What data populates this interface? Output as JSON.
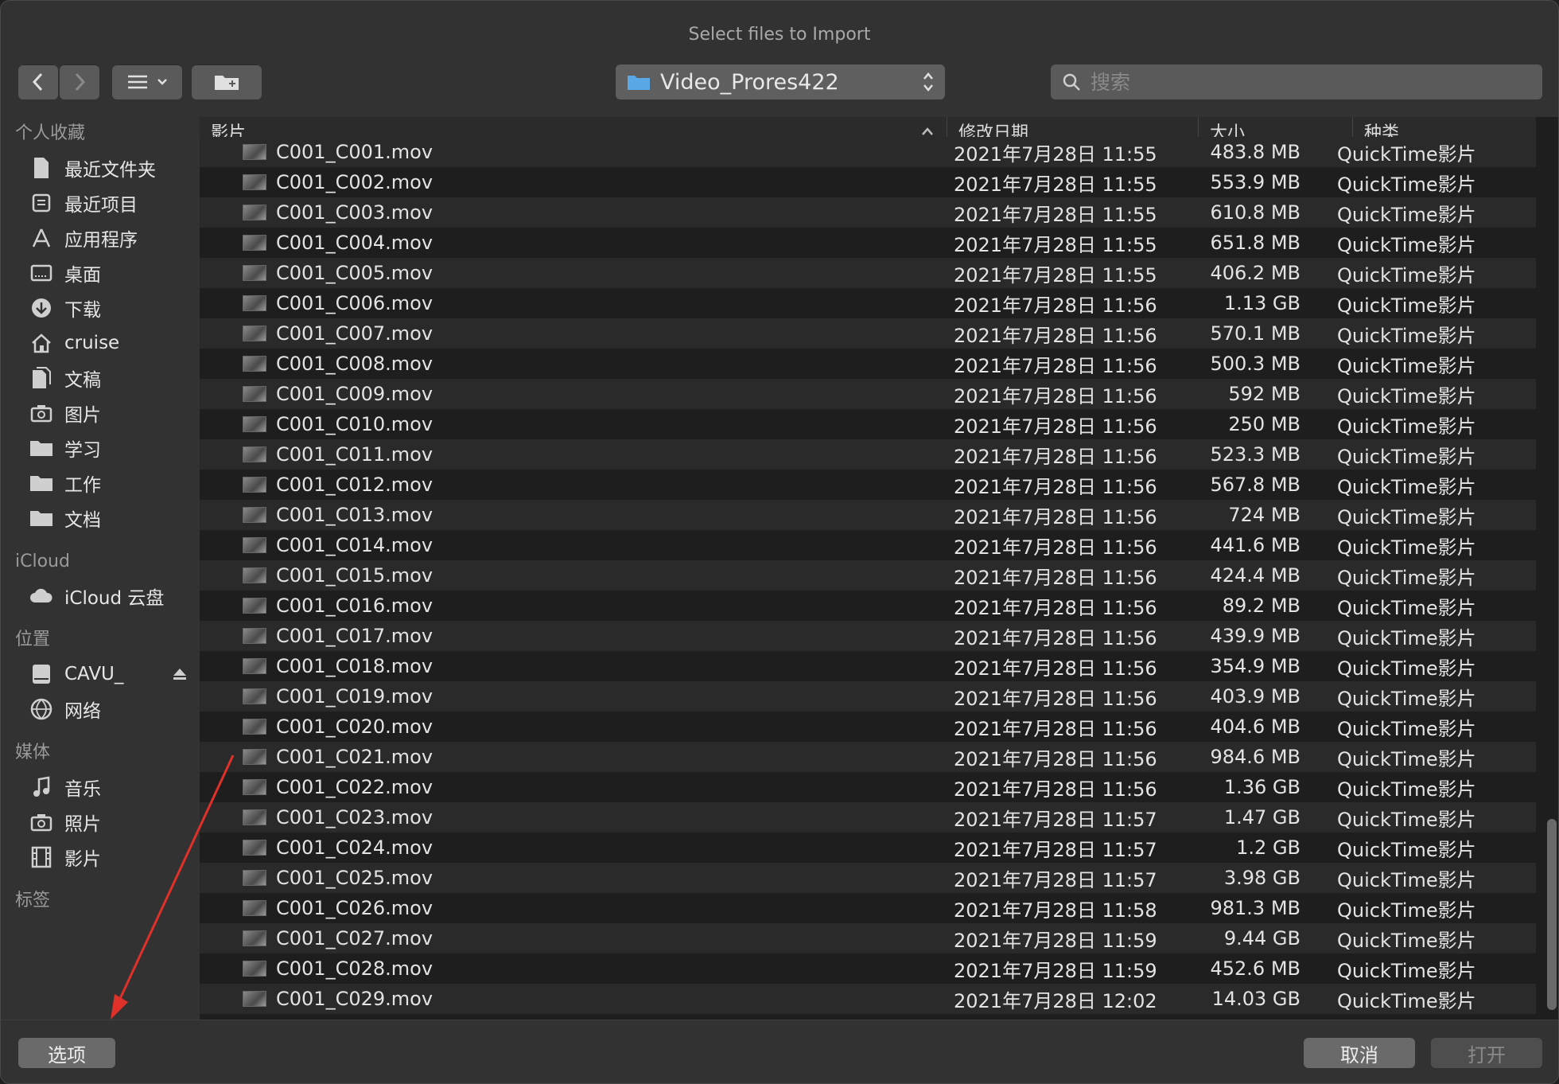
{
  "window": {
    "title": "Select files to Import"
  },
  "toolbar": {
    "path": "Video_Prores422",
    "search_placeholder": "搜索"
  },
  "sidebar": {
    "sections": [
      {
        "label": "个人收藏",
        "items": [
          {
            "label": "最近文件夹",
            "icon": "document-icon"
          },
          {
            "label": "最近项目",
            "icon": "recents-icon"
          },
          {
            "label": "应用程序",
            "icon": "applications-icon"
          },
          {
            "label": "桌面",
            "icon": "desktop-icon"
          },
          {
            "label": "下载",
            "icon": "download-icon"
          },
          {
            "label": "cruise",
            "icon": "home-icon"
          },
          {
            "label": "文稿",
            "icon": "documents-icon"
          },
          {
            "label": "图片",
            "icon": "camera-icon"
          },
          {
            "label": "学习",
            "icon": "folder-icon"
          },
          {
            "label": "工作",
            "icon": "folder-icon"
          },
          {
            "label": "文档",
            "icon": "folder-icon"
          }
        ]
      },
      {
        "label": "iCloud",
        "items": [
          {
            "label": "iCloud 云盘",
            "icon": "cloud-icon"
          }
        ]
      },
      {
        "label": "位置",
        "items": [
          {
            "label": "CAVU_",
            "icon": "drive-icon"
          },
          {
            "label": "网络",
            "icon": "network-icon"
          }
        ]
      },
      {
        "label": "媒体",
        "items": [
          {
            "label": "音乐",
            "icon": "music-icon"
          },
          {
            "label": "照片",
            "icon": "camera-icon"
          },
          {
            "label": "影片",
            "icon": "film-icon"
          }
        ]
      },
      {
        "label": "标签",
        "items": []
      }
    ]
  },
  "table": {
    "columns": [
      "影片",
      "修改日期",
      "大小",
      "种类"
    ],
    "rows": [
      [
        "C001_C001.mov",
        "2021年7月28日 11:55",
        "483.8 MB",
        "QuickTime影片"
      ],
      [
        "C001_C002.mov",
        "2021年7月28日 11:55",
        "553.9 MB",
        "QuickTime影片"
      ],
      [
        "C001_C003.mov",
        "2021年7月28日 11:55",
        "610.8 MB",
        "QuickTime影片"
      ],
      [
        "C001_C004.mov",
        "2021年7月28日 11:55",
        "651.8 MB",
        "QuickTime影片"
      ],
      [
        "C001_C005.mov",
        "2021年7月28日 11:55",
        "406.2 MB",
        "QuickTime影片"
      ],
      [
        "C001_C006.mov",
        "2021年7月28日 11:56",
        "1.13 GB",
        "QuickTime影片"
      ],
      [
        "C001_C007.mov",
        "2021年7月28日 11:56",
        "570.1 MB",
        "QuickTime影片"
      ],
      [
        "C001_C008.mov",
        "2021年7月28日 11:56",
        "500.3 MB",
        "QuickTime影片"
      ],
      [
        "C001_C009.mov",
        "2021年7月28日 11:56",
        "592 MB",
        "QuickTime影片"
      ],
      [
        "C001_C010.mov",
        "2021年7月28日 11:56",
        "250 MB",
        "QuickTime影片"
      ],
      [
        "C001_C011.mov",
        "2021年7月28日 11:56",
        "523.3 MB",
        "QuickTime影片"
      ],
      [
        "C001_C012.mov",
        "2021年7月28日 11:56",
        "567.8 MB",
        "QuickTime影片"
      ],
      [
        "C001_C013.mov",
        "2021年7月28日 11:56",
        "724 MB",
        "QuickTime影片"
      ],
      [
        "C001_C014.mov",
        "2021年7月28日 11:56",
        "441.6 MB",
        "QuickTime影片"
      ],
      [
        "C001_C015.mov",
        "2021年7月28日 11:56",
        "424.4 MB",
        "QuickTime影片"
      ],
      [
        "C001_C016.mov",
        "2021年7月28日 11:56",
        "89.2 MB",
        "QuickTime影片"
      ],
      [
        "C001_C017.mov",
        "2021年7月28日 11:56",
        "439.9 MB",
        "QuickTime影片"
      ],
      [
        "C001_C018.mov",
        "2021年7月28日 11:56",
        "354.9 MB",
        "QuickTime影片"
      ],
      [
        "C001_C019.mov",
        "2021年7月28日 11:56",
        "403.9 MB",
        "QuickTime影片"
      ],
      [
        "C001_C020.mov",
        "2021年7月28日 11:56",
        "404.6 MB",
        "QuickTime影片"
      ],
      [
        "C001_C021.mov",
        "2021年7月28日 11:56",
        "984.6 MB",
        "QuickTime影片"
      ],
      [
        "C001_C022.mov",
        "2021年7月28日 11:56",
        "1.36 GB",
        "QuickTime影片"
      ],
      [
        "C001_C023.mov",
        "2021年7月28日 11:57",
        "1.47 GB",
        "QuickTime影片"
      ],
      [
        "C001_C024.mov",
        "2021年7月28日 11:57",
        "1.2 GB",
        "QuickTime影片"
      ],
      [
        "C001_C025.mov",
        "2021年7月28日 11:57",
        "3.98 GB",
        "QuickTime影片"
      ],
      [
        "C001_C026.mov",
        "2021年7月28日 11:58",
        "981.3 MB",
        "QuickTime影片"
      ],
      [
        "C001_C027.mov",
        "2021年7月28日 11:59",
        "9.44 GB",
        "QuickTime影片"
      ],
      [
        "C001_C028.mov",
        "2021年7月28日 11:59",
        "452.6 MB",
        "QuickTime影片"
      ],
      [
        "C001_C029.mov",
        "2021年7月28日 12:02",
        "14.03 GB",
        "QuickTime影片"
      ]
    ]
  },
  "footer": {
    "options_label": "选项",
    "cancel_label": "取消",
    "open_label": "打开"
  },
  "colors": {
    "annotation_arrow": "#e0302a",
    "folder_blue": "#5aa9e6"
  }
}
